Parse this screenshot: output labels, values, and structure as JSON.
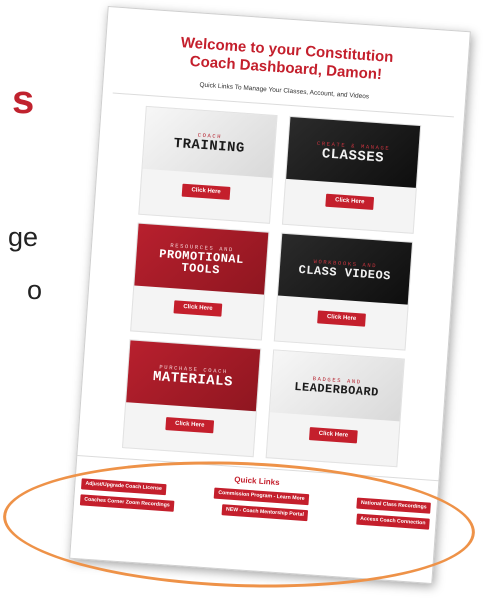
{
  "background_fragments": {
    "s": "s",
    "ge": "ge",
    "o": "o"
  },
  "header": {
    "welcome_line1": "Welcome to your Constitution",
    "welcome_line2": "Coach Dashboard, Damon!",
    "subtitle": "Quick Links To Manage Your Classes, Account, and Videos"
  },
  "cards": [
    {
      "small": "COACH",
      "big": "TRAINING",
      "button": "Click Here"
    },
    {
      "small": "CREATE & MANAGE",
      "big": "CLASSES",
      "button": "Click Here"
    },
    {
      "small": "RESOURCES AND",
      "big": "PROMOTIONAL",
      "big2": "TOOLS",
      "button": "Click Here"
    },
    {
      "small": "WORKBOOKS AND",
      "big": "CLASS VIDEOS",
      "button": "Click Here"
    },
    {
      "small": "PURCHASE COACH",
      "big": "MATERIALS",
      "button": "Click Here"
    },
    {
      "small": "BADGES AND",
      "big": "LEADERBOARD",
      "button": "Click Here"
    }
  ],
  "quick_links": {
    "title": "Quick Links",
    "row1": [
      "Adjust/Upgrade Coach License",
      "Commission Program - Learn More",
      "National Class Recordings"
    ],
    "row2": [
      "Coaches Corner Zoom Recordings",
      "NEW - Coach Mentorship Portal",
      "Access Coach Connection"
    ]
  },
  "colors": {
    "brand_red": "#c41f2c",
    "highlight_orange": "#ee9248"
  }
}
